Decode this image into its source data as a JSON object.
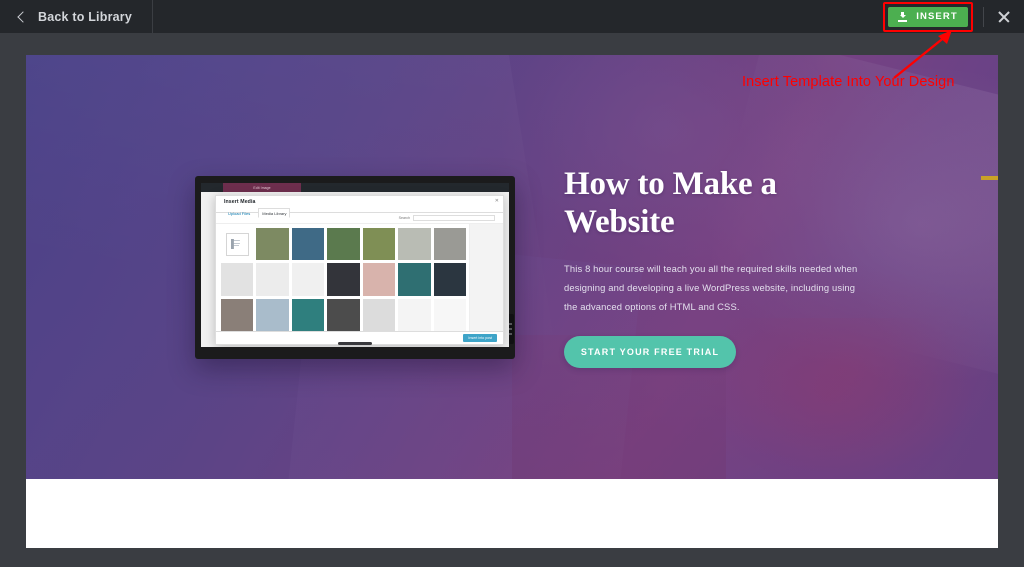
{
  "topbar": {
    "back_label": "Back to Library",
    "back_icon": "chevron-left-icon",
    "insert_label": "INSERT",
    "insert_icon": "download-icon",
    "close_icon": "close-icon",
    "insert_color": "#4caf50"
  },
  "annotation": {
    "text": "Insert Template Into Your Design",
    "color": "#ff0000",
    "arrow_target": "insert-button"
  },
  "preview": {
    "hero": {
      "title": "How to Make a Website",
      "body": "This 8 hour course will teach you all the required skills needed when designing and developing a live WordPress website, including using the advanced options of HTML and CSS.",
      "cta_label": "START YOUR FREE TRIAL",
      "cta_color": "#53c4ab",
      "accent_mark_color": "#c9a227",
      "overlay_color": "#4c4682"
    },
    "device": {
      "browser_tab_label": "Edit Image",
      "modal": {
        "title": "Insert Media",
        "close_icon": "close-icon",
        "tabs": [
          {
            "label": "Upload Files",
            "active": false
          },
          {
            "label": "Media Library",
            "active": true
          }
        ],
        "search_label": "Search",
        "search_placeholder": "",
        "insert_button_label": "Insert into post",
        "thumbs": [
          {
            "name": "document-icon-thumb",
            "kind": "doc"
          },
          {
            "name": "hiker-field-thumb",
            "color": "#7d8a62"
          },
          {
            "name": "lake-dock-thumb",
            "color": "#3f6a86"
          },
          {
            "name": "green-valley-thumb",
            "color": "#5b7a4e"
          },
          {
            "name": "forest-path-thumb",
            "color": "#7f8f55"
          },
          {
            "name": "foggy-sea-thumb",
            "color": "#b9bcb4"
          },
          {
            "name": "road-car-thumb",
            "color": "#9a9a95"
          },
          {
            "name": "placeholder-grey-thumb",
            "color": "#e2e2e2"
          },
          {
            "name": "placeholder-light-thumb",
            "color": "#ececec"
          },
          {
            "name": "placeholder-pale-thumb",
            "color": "#f0f0f0"
          },
          {
            "name": "dark-quote-thumb",
            "color": "#33343a"
          },
          {
            "name": "pink-abstract-thumb",
            "color": "#d8b3ac"
          },
          {
            "name": "teal-cove-thumb",
            "color": "#2f6f72"
          },
          {
            "name": "night-forest-thumb",
            "color": "#2b3640"
          },
          {
            "name": "photographer-thumb",
            "color": "#8a7f78"
          },
          {
            "name": "blue-window-thumb",
            "color": "#a9bccb"
          },
          {
            "name": "ocean-wave-thumb",
            "color": "#2f7f7e"
          },
          {
            "name": "dark-landscape-thumb",
            "color": "#4c4c4c"
          },
          {
            "name": "screenshot-thumb",
            "color": "#dcdcdc"
          },
          {
            "name": "teal-logo-thumb",
            "color": "#f4f4f4"
          },
          {
            "name": "green-swirl-logo-thumb",
            "color": "#f7f7f7"
          },
          {
            "name": "blue-diamond-logo-thumb",
            "color": "#fbfbfb"
          },
          {
            "name": "green-room-thumb",
            "color": "#7c7f52"
          },
          {
            "name": "portrait-beanie-thumb",
            "color": "#6f5b54"
          },
          {
            "name": "portrait-glasses-thumb",
            "color": "#7b7269"
          },
          {
            "name": "portrait-woman-thumb",
            "color": "#5b5570"
          },
          {
            "name": "hand-camera-thumb",
            "color": "#4a4a52"
          },
          {
            "name": "cube-pattern-thumb",
            "color": "#f2f2f6"
          },
          {
            "name": "strip-grey-thumb",
            "color": "#b9b9b9"
          },
          {
            "name": "strip-dark-thumb",
            "color": "#1d2230"
          },
          {
            "name": "strip-blue-thumb",
            "color": "#5aa7d4"
          },
          {
            "name": "strip-warm-thumb",
            "color": "#b08a72"
          },
          {
            "name": "strip-black-thumb",
            "color": "#2a2a2a"
          },
          {
            "name": "strip-portrait-thumb",
            "color": "#c9b3a6"
          },
          {
            "name": "strip-skin-thumb",
            "color": "#e2c6bb"
          }
        ]
      }
    }
  }
}
